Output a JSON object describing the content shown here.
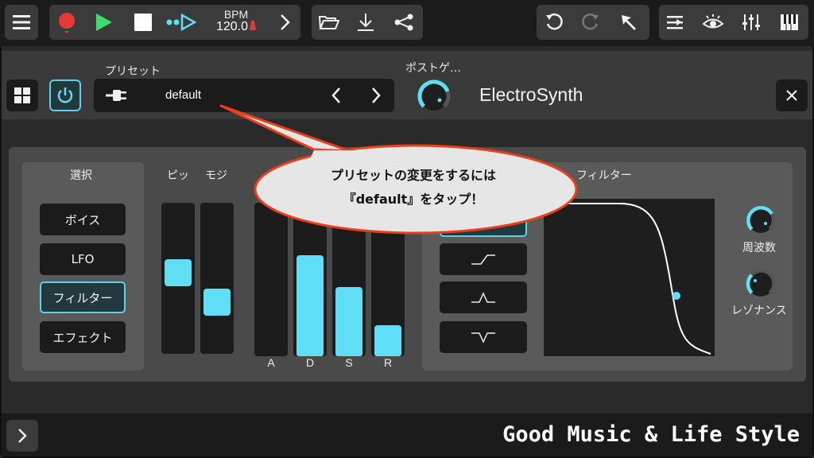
{
  "toolbar": {
    "bpm_label": "BPM",
    "bpm_value": "120.0",
    "icons": [
      "menu-icon",
      "record-icon",
      "play-icon",
      "stop-icon",
      "step-sequence-icon",
      "chevron-right-icon",
      "folder-open-icon",
      "download-icon",
      "share-icon",
      "undo-icon",
      "redo-icon",
      "cursor-arrow-icon",
      "tracks-list-icon",
      "eye-icon",
      "mixer-sliders-icon",
      "piano-keys-icon"
    ]
  },
  "plugin": {
    "preset_label": "プリセット",
    "preset_value": "default",
    "postgain_label": "ポストゲ…",
    "name": "ElectroSynth"
  },
  "selection": {
    "title": "選択",
    "buttons": [
      "ボイス",
      "LFO",
      "フィルター",
      "エフェクト"
    ],
    "active": "フィルター"
  },
  "sliders": {
    "pitch_label": "ピッ",
    "mod_label": "モジ",
    "pitch_value": 0.55,
    "mod_value": 0.3
  },
  "adsr": {
    "labels": [
      "A",
      "D",
      "S",
      "R"
    ],
    "values": [
      0.0,
      0.66,
      0.45,
      0.2
    ]
  },
  "filter": {
    "title": "フィルター",
    "freq_label": "周波数",
    "reso_label": "レゾナンス"
  },
  "callout": {
    "line1": "プリセットの変更をするには",
    "line2": "『default』をタップ！"
  },
  "footer": {
    "brand": "Good Music & Life Style"
  },
  "colors": {
    "accent": "#60def5",
    "record": "#e53935",
    "play": "#3ddc6c",
    "callout_border": "#e8401c"
  }
}
